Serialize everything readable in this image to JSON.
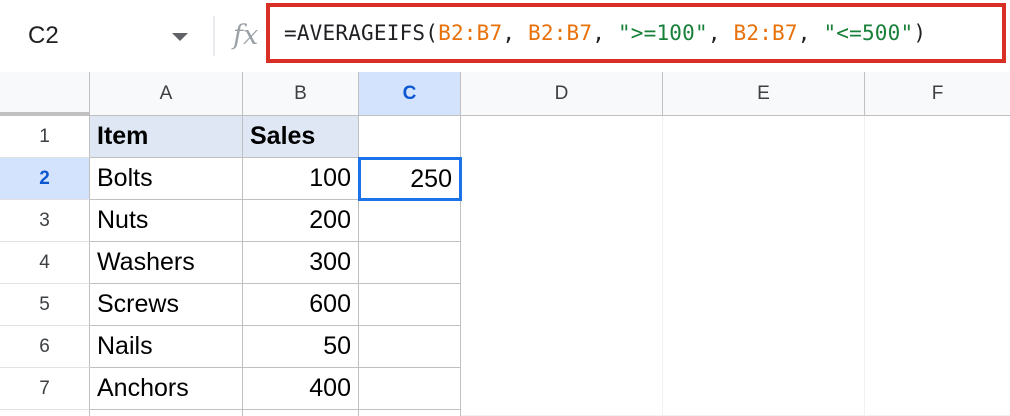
{
  "name_box": {
    "ref": "C2"
  },
  "formula_bar": {
    "fx": "fx",
    "parts": [
      "=AVERAGEIFS(",
      "B2:B7",
      ", ",
      "B2:B7",
      ", ",
      "\">=100\"",
      ", ",
      "B2:B7",
      ", ",
      "\"<=500\"",
      ")"
    ]
  },
  "columns": [
    "A",
    "B",
    "C",
    "D",
    "E",
    "F"
  ],
  "rows": [
    "1",
    "2",
    "3",
    "4",
    "5",
    "6",
    "7"
  ],
  "cells": {
    "A1": "Item",
    "B1": "Sales",
    "A2": "Bolts",
    "B2": "100",
    "C2": "250",
    "A3": "Nuts",
    "B3": "200",
    "A4": "Washers",
    "B4": "300",
    "A5": "Screws",
    "B5": "600",
    "A6": "Nails",
    "B6": "50",
    "A7": "Anchors",
    "B7": "400"
  },
  "colors": {
    "highlight_border": "#d93025",
    "selection": "#1a73e8",
    "range_ref": "#e8710a",
    "string_lit": "#188038",
    "header_fill": "#dee7f3"
  }
}
